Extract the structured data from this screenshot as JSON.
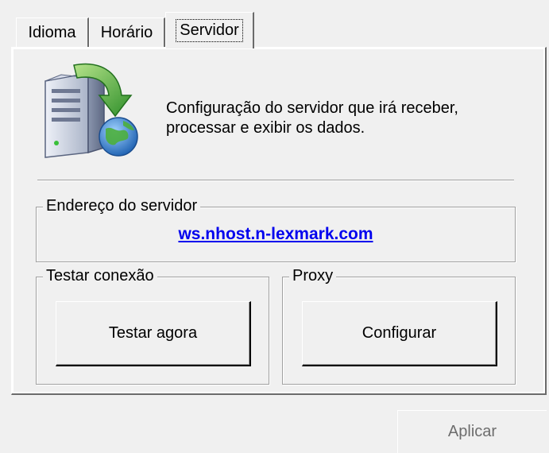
{
  "tabs": [
    {
      "label": "Idioma",
      "active": false
    },
    {
      "label": "Horário",
      "active": false
    },
    {
      "label": "Servidor",
      "active": true
    }
  ],
  "header": {
    "icon": "server-download-globe-icon",
    "description_line1": "Configuração do servidor que irá receber,",
    "description_line2": "processar e exibir os dados."
  },
  "server_group": {
    "legend": "Endereço do servidor",
    "address": "ws.nhost.n-lexmark.com"
  },
  "test_group": {
    "legend": "Testar conexão",
    "button_label": "Testar agora"
  },
  "proxy_group": {
    "legend": "Proxy",
    "button_label": "Configurar"
  },
  "footer": {
    "apply_label": "Aplicar"
  },
  "colors": {
    "link": "#0000ee",
    "face": "#f0f0f0",
    "disabled_text": "#6d6d6d"
  }
}
